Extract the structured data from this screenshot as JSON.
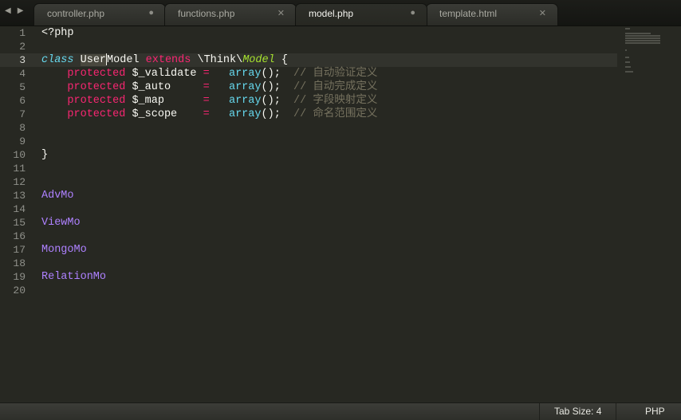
{
  "navigation": {
    "back_label": "◀",
    "forward_label": "▶"
  },
  "tabs": [
    {
      "label": "controller.php",
      "status": "●",
      "active": false
    },
    {
      "label": "functions.php",
      "status": "✕",
      "active": false
    },
    {
      "label": "model.php",
      "status": "●",
      "active": true
    },
    {
      "label": "template.html",
      "status": "✕",
      "active": false
    }
  ],
  "line_numbers": [
    "1",
    "2",
    "3",
    "4",
    "5",
    "6",
    "7",
    "8",
    "9",
    "10",
    "11",
    "12",
    "13",
    "14",
    "15",
    "16",
    "17",
    "18",
    "19",
    "20"
  ],
  "code": {
    "line1": "<?php",
    "line3": {
      "class_kw": "class",
      "name_a": "User",
      "name_b": "Model",
      "extends_kw": "extends",
      "ns": "\\Think\\",
      "parent": "Model",
      "brace": " {"
    },
    "props": [
      {
        "kw": "protected",
        "var": "$_validate",
        "eq": "=",
        "fn": "array",
        "tail": "();",
        "comment": "// 自动验证定义"
      },
      {
        "kw": "protected",
        "var": "$_auto    ",
        "eq": "=",
        "fn": "array",
        "tail": "();",
        "comment": "// 自动完成定义"
      },
      {
        "kw": "protected",
        "var": "$_map     ",
        "eq": "=",
        "fn": "array",
        "tail": "();",
        "comment": "// 字段映射定义"
      },
      {
        "kw": "protected",
        "var": "$_scope   ",
        "eq": "=",
        "fn": "array",
        "tail": "();",
        "comment": "// 命名范围定义"
      }
    ],
    "close_brace": "}",
    "line13": "AdvMo",
    "line15": "ViewMo",
    "line17": "MongoMo",
    "line19": "RelationMo"
  },
  "status_bar": {
    "tab_size": "Tab Size: 4",
    "syntax": "PHP"
  },
  "colors": {
    "background": "#272822",
    "keyword": "#f92672",
    "storage": "#66d9ef",
    "inherited": "#a6e22e",
    "constant": "#ae81ff",
    "comment": "#75715e"
  }
}
